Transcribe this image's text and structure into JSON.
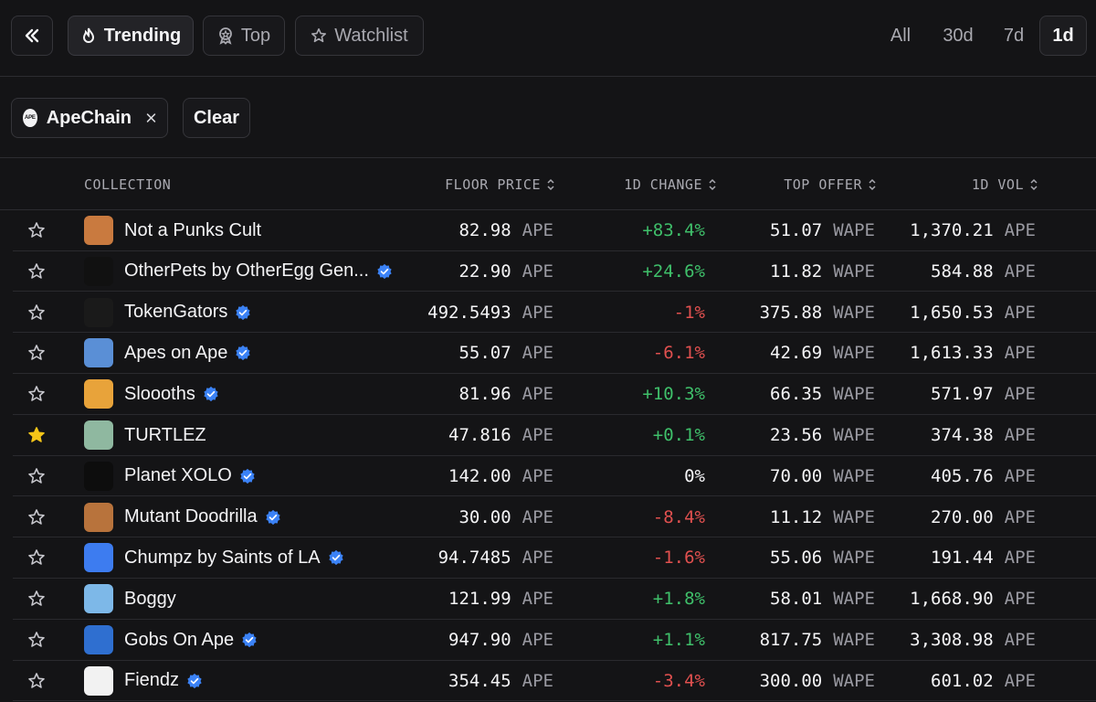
{
  "toolbar": {
    "tabs": [
      {
        "label": "Trending",
        "icon": "flame-icon",
        "active": true
      },
      {
        "label": "Top",
        "icon": "award-icon",
        "active": false
      },
      {
        "label": "Watchlist",
        "icon": "star-icon",
        "active": false
      }
    ],
    "time_filters": [
      {
        "label": "All",
        "active": false
      },
      {
        "label": "30d",
        "active": false
      },
      {
        "label": "7d",
        "active": false
      },
      {
        "label": "1d",
        "active": true
      }
    ]
  },
  "filters": {
    "chip_label": "ApeChain",
    "chip_logo_text": "APE",
    "clear_label": "Clear"
  },
  "table": {
    "headers": {
      "collection": "COLLECTION",
      "floor_price": "FLOOR PRICE",
      "change": "1D CHANGE",
      "top_offer": "TOP OFFER",
      "volume": "1D VOL"
    },
    "rows": [
      {
        "name": "Not a Punks Cult",
        "verified": false,
        "starred": false,
        "avatar_color": "#c97a3f",
        "floor": "82.98",
        "floor_unit": "APE",
        "change": "+83.4%",
        "trend": "pos",
        "offer": "51.07",
        "offer_unit": "WAPE",
        "vol": "1,370.21",
        "vol_unit": "APE"
      },
      {
        "name": "OtherPets by OtherEgg Gen...",
        "verified": true,
        "starred": false,
        "avatar_color": "#111111",
        "floor": "22.90",
        "floor_unit": "APE",
        "change": "+24.6%",
        "trend": "pos",
        "offer": "11.82",
        "offer_unit": "WAPE",
        "vol": "584.88",
        "vol_unit": "APE"
      },
      {
        "name": "TokenGators",
        "verified": true,
        "starred": false,
        "avatar_color": "#1a1a1a",
        "floor": "492.5493",
        "floor_unit": "APE",
        "change": "-1%",
        "trend": "neg",
        "offer": "375.88",
        "offer_unit": "WAPE",
        "vol": "1,650.53",
        "vol_unit": "APE"
      },
      {
        "name": "Apes on Ape",
        "verified": true,
        "starred": false,
        "avatar_color": "#5a8fd6",
        "floor": "55.07",
        "floor_unit": "APE",
        "change": "-6.1%",
        "trend": "neg",
        "offer": "42.69",
        "offer_unit": "WAPE",
        "vol": "1,613.33",
        "vol_unit": "APE"
      },
      {
        "name": "Sloooths",
        "verified": true,
        "starred": false,
        "avatar_color": "#e8a33a",
        "floor": "81.96",
        "floor_unit": "APE",
        "change": "+10.3%",
        "trend": "pos",
        "offer": "66.35",
        "offer_unit": "WAPE",
        "vol": "571.97",
        "vol_unit": "APE"
      },
      {
        "name": "TURTLEZ",
        "verified": false,
        "starred": true,
        "avatar_color": "#8fb8a0",
        "floor": "47.816",
        "floor_unit": "APE",
        "change": "+0.1%",
        "trend": "pos",
        "offer": "23.56",
        "offer_unit": "WAPE",
        "vol": "374.38",
        "vol_unit": "APE"
      },
      {
        "name": "Planet XOLO",
        "verified": true,
        "starred": false,
        "avatar_color": "#0d0d0d",
        "floor": "142.00",
        "floor_unit": "APE",
        "change": "0%",
        "trend": "neu",
        "offer": "70.00",
        "offer_unit": "WAPE",
        "vol": "405.76",
        "vol_unit": "APE"
      },
      {
        "name": "Mutant Doodrilla",
        "verified": true,
        "starred": false,
        "avatar_color": "#b8733c",
        "floor": "30.00",
        "floor_unit": "APE",
        "change": "-8.4%",
        "trend": "neg",
        "offer": "11.12",
        "offer_unit": "WAPE",
        "vol": "270.00",
        "vol_unit": "APE"
      },
      {
        "name": "Chumpz by Saints of LA",
        "verified": true,
        "starred": false,
        "avatar_color": "#3d7cf0",
        "floor": "94.7485",
        "floor_unit": "APE",
        "change": "-1.6%",
        "trend": "neg",
        "offer": "55.06",
        "offer_unit": "WAPE",
        "vol": "191.44",
        "vol_unit": "APE"
      },
      {
        "name": "Boggy",
        "verified": false,
        "starred": false,
        "avatar_color": "#7db8e8",
        "floor": "121.99",
        "floor_unit": "APE",
        "change": "+1.8%",
        "trend": "pos",
        "offer": "58.01",
        "offer_unit": "WAPE",
        "vol": "1,668.90",
        "vol_unit": "APE"
      },
      {
        "name": "Gobs On Ape",
        "verified": true,
        "starred": false,
        "avatar_color": "#2f6fd0",
        "floor": "947.90",
        "floor_unit": "APE",
        "change": "+1.1%",
        "trend": "pos",
        "offer": "817.75",
        "offer_unit": "WAPE",
        "vol": "3,308.98",
        "vol_unit": "APE"
      },
      {
        "name": "Fiendz",
        "verified": true,
        "starred": false,
        "avatar_color": "#f2f2f2",
        "floor": "354.45",
        "floor_unit": "APE",
        "change": "-3.4%",
        "trend": "neg",
        "offer": "300.00",
        "offer_unit": "WAPE",
        "vol": "601.02",
        "vol_unit": "APE"
      }
    ]
  },
  "colors": {
    "positive": "#3fbf6a",
    "negative": "#e0504f",
    "verified": "#3b82f6",
    "star_filled": "#f5c518"
  }
}
